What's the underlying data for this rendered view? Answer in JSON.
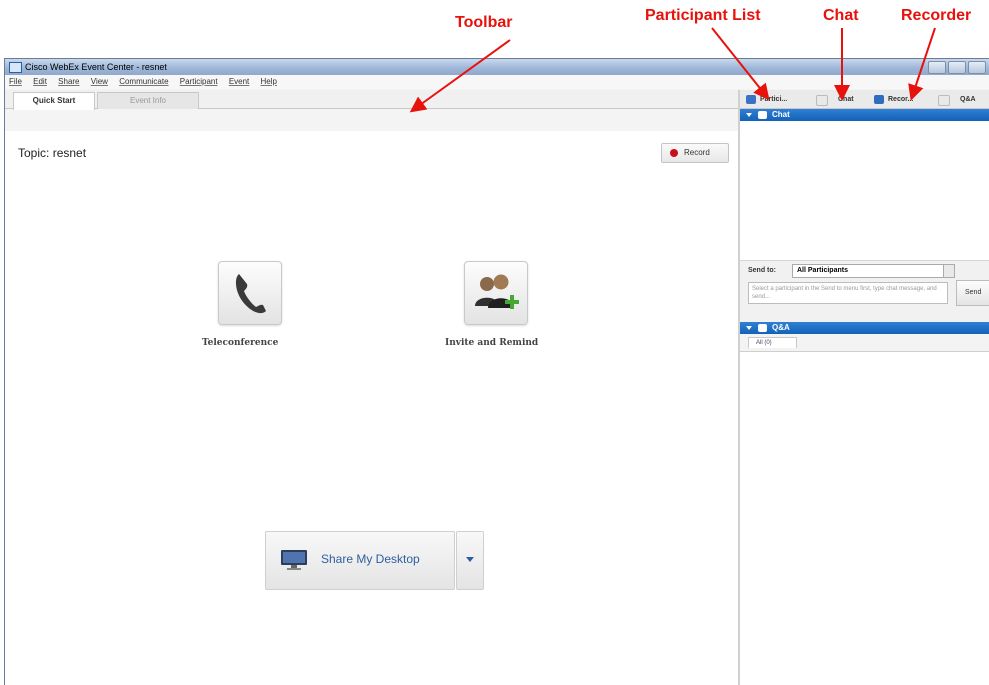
{
  "annotations": {
    "toolbar": "Toolbar",
    "participant_list": "Participant List",
    "chat": "Chat",
    "recorder": "Recorder"
  },
  "window": {
    "title": "Cisco WebEx Event Center - resnet"
  },
  "menu": [
    "File",
    "Edit",
    "Share",
    "View",
    "Communicate",
    "Participant",
    "Event",
    "Help"
  ],
  "tabs": {
    "quick_start": "Quick Start",
    "event_info": "Event Info"
  },
  "main": {
    "topic_label": "Topic:",
    "topic_value": "resnet",
    "record_label": "Record",
    "teleconference_label": "Teleconference",
    "invite_label": "Invite and Remind",
    "share_label": "Share My Desktop"
  },
  "right": {
    "tabs": [
      "Partici...",
      "Chat",
      "Recor...",
      "Q&A"
    ],
    "chat_header": "Chat",
    "send_to_label": "Send to:",
    "send_to_value": "All Participants",
    "message_placeholder": "Select a participant in the Send to menu first, type chat message, and send...",
    "send_button": "Send",
    "qa_header": "Q&A",
    "qa_tab": "All (0)"
  },
  "colors": {
    "annotation": "#e8120c",
    "panel_header": "#1a6cc4",
    "record_dot": "#c8101a"
  }
}
